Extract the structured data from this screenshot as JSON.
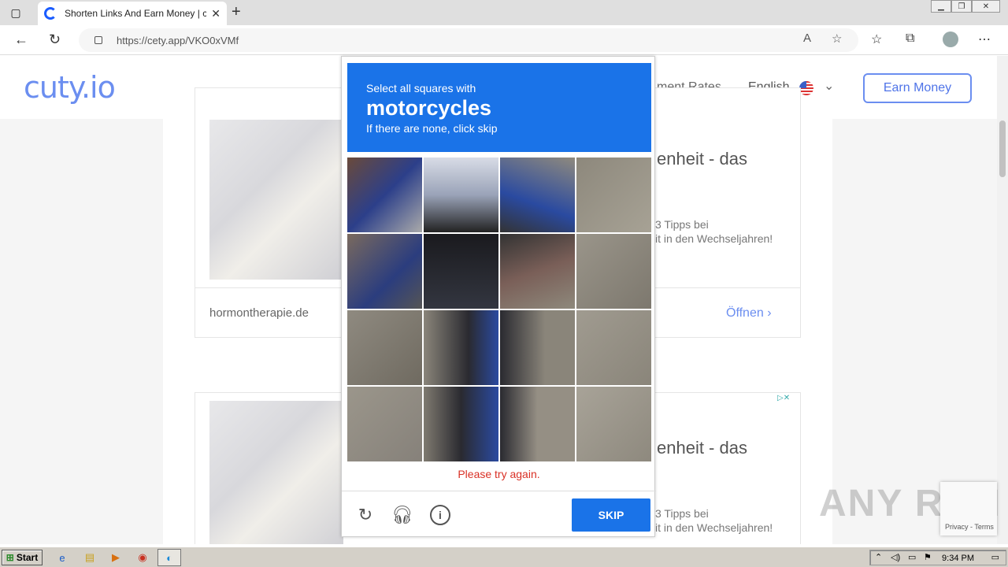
{
  "browser": {
    "tab_title": "Shorten Links And Earn Money | c",
    "url": "https://cety.app/VKO0xVMf"
  },
  "site": {
    "logo": "cuty.io",
    "nav_rates": "ment Rates",
    "language": "English",
    "earn_button": "Earn Money"
  },
  "ads": [
    {
      "headline": "enheit - das",
      "body_line1": "3 Tipps bei",
      "body_line2": "it in den Wechseljahren!",
      "domain": "hormontherapie.de",
      "open_label": "Öffnen"
    },
    {
      "headline": "enheit - das",
      "body_line1": "3 Tipps bei",
      "body_line2": "it in den Wechseljahren!"
    }
  ],
  "captcha": {
    "line1": "Select all squares with",
    "target": "motorcycles",
    "line3": "If there are none, click skip",
    "error": "Please try again.",
    "skip_label": "SKIP"
  },
  "recaptcha_badge": "Privacy - Terms",
  "watermark": "ANY RUN",
  "taskbar": {
    "start_label": "Start",
    "time": "9:34 PM"
  }
}
